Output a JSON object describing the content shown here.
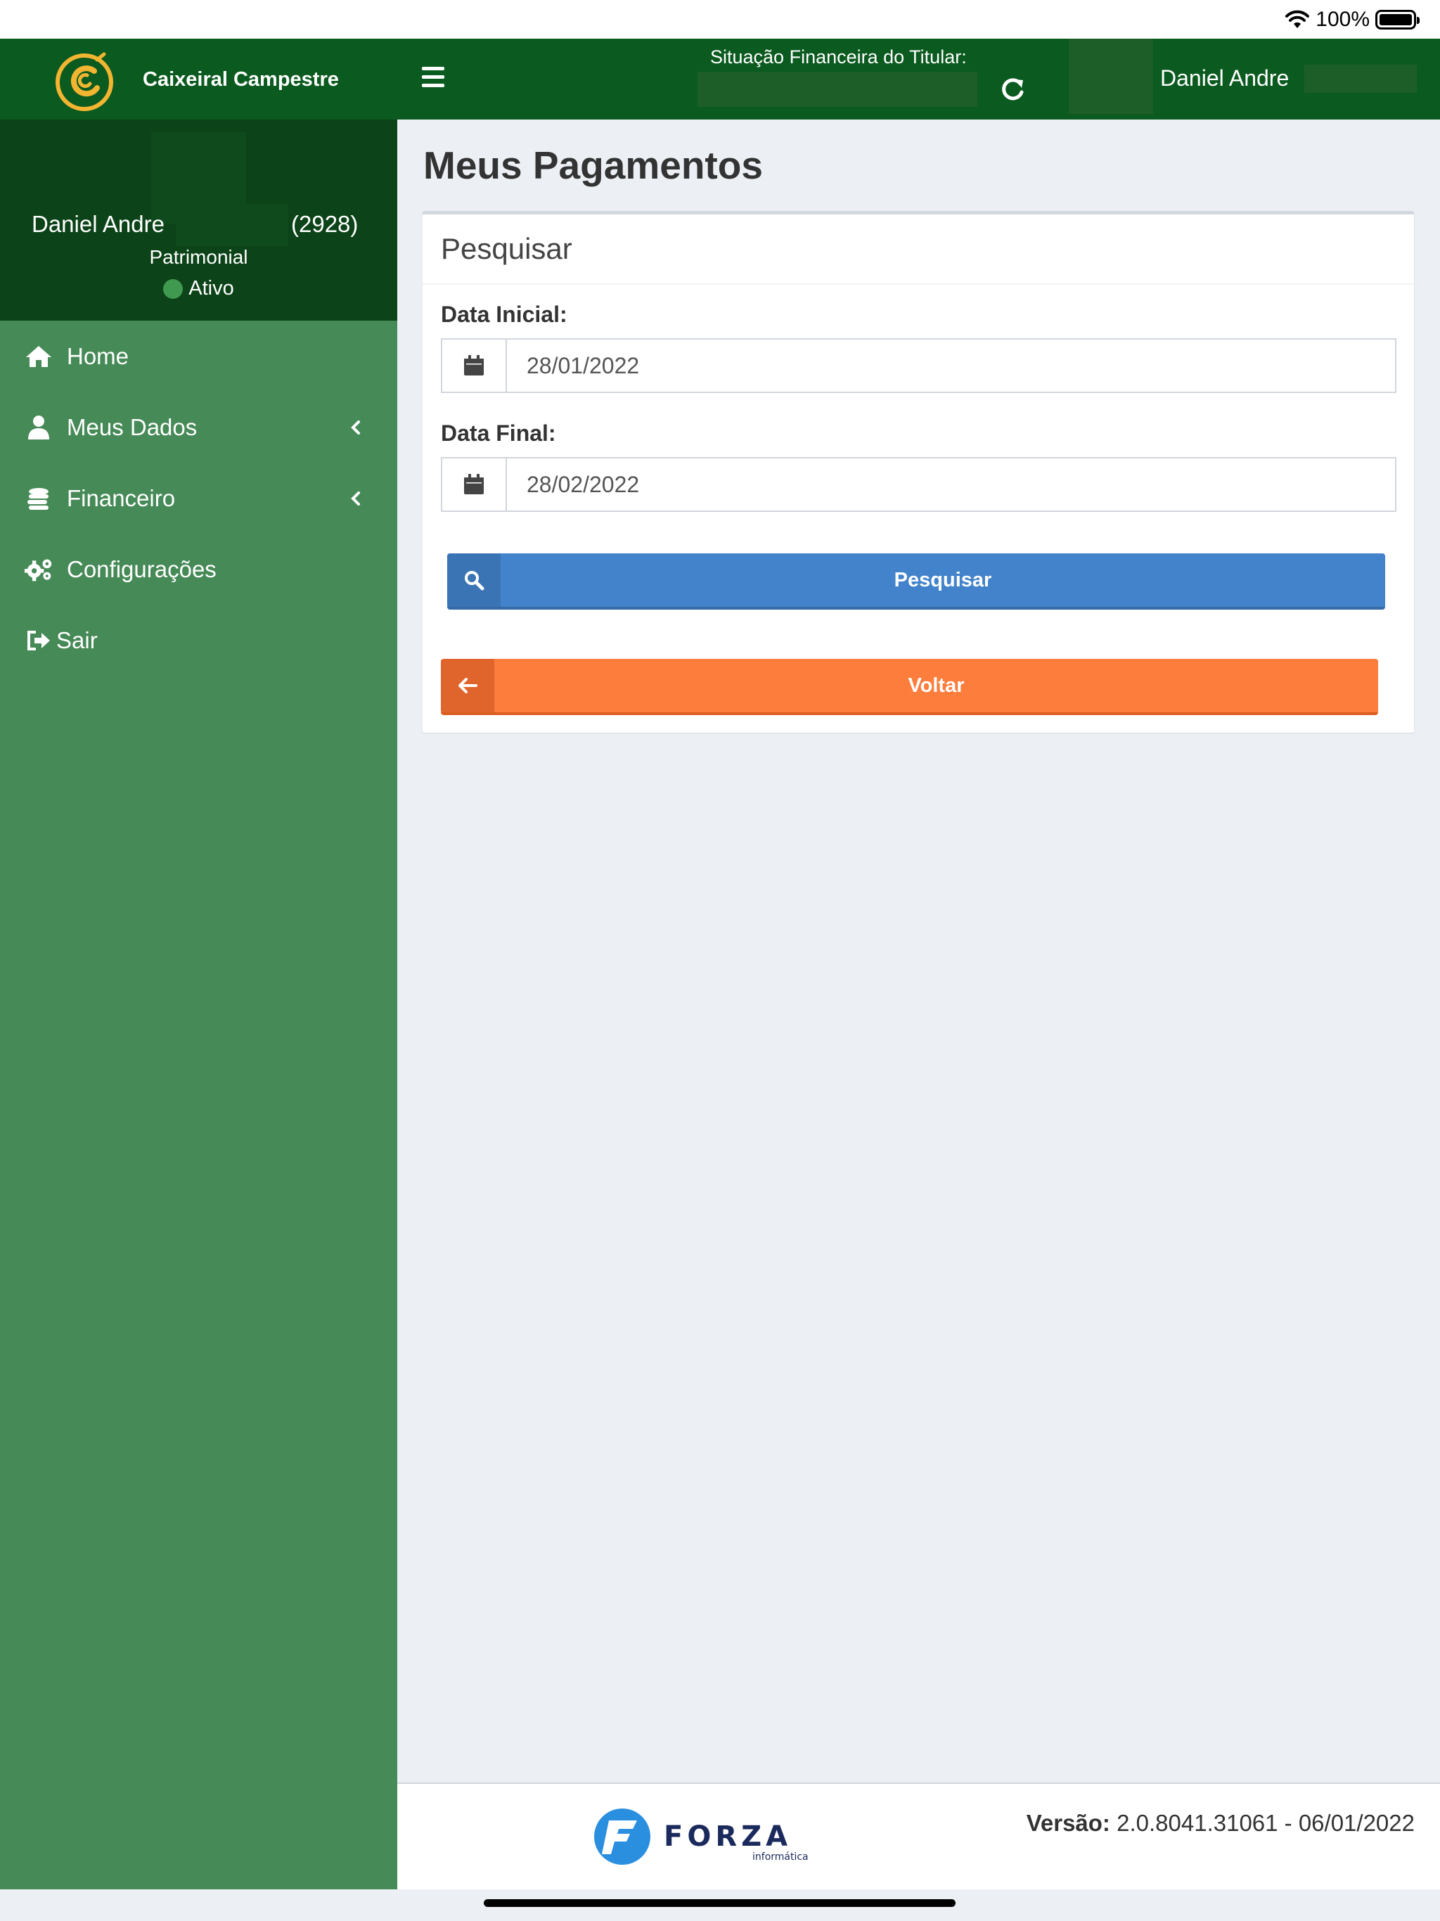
{
  "status_bar": {
    "battery_percent": "100%"
  },
  "header": {
    "brand_name": "Caixeiral Campestre",
    "financial_label": "Situação Financeira do Titular:",
    "user_name": "Daniel Andre"
  },
  "user_panel": {
    "name": "Daniel Andre",
    "member_id": "(2928)",
    "plan": "Patrimonial",
    "status": "Ativo"
  },
  "menu": [
    {
      "label": "Home",
      "icon": "home-icon"
    },
    {
      "label": "Meus Dados",
      "icon": "user-icon"
    },
    {
      "label": "Financeiro",
      "icon": "coins-icon"
    },
    {
      "label": "Configurações",
      "icon": "gears-icon"
    },
    {
      "label": "Sair",
      "icon": "sign-out-icon"
    }
  ],
  "page": {
    "title": "Meus Pagamentos",
    "box_title": "Pesquisar",
    "start_label": "Data Inicial:",
    "start_value": "28/01/2022",
    "end_label": "Data Final:",
    "end_value": "28/02/2022",
    "search_button": "Pesquisar",
    "back_button": "Voltar"
  },
  "footer": {
    "logo_text": "FORZA",
    "logo_subtext": "informática",
    "version_label": "Versão:",
    "version_value": "2.0.8041.31061 - 06/01/2022"
  },
  "colors": {
    "header_bg": "#0b5a1f",
    "sidebar_bg": "#468a57",
    "user_panel_bg": "#0c4318",
    "search_button": "#4283cc",
    "back_button": "#fc7d3c"
  }
}
